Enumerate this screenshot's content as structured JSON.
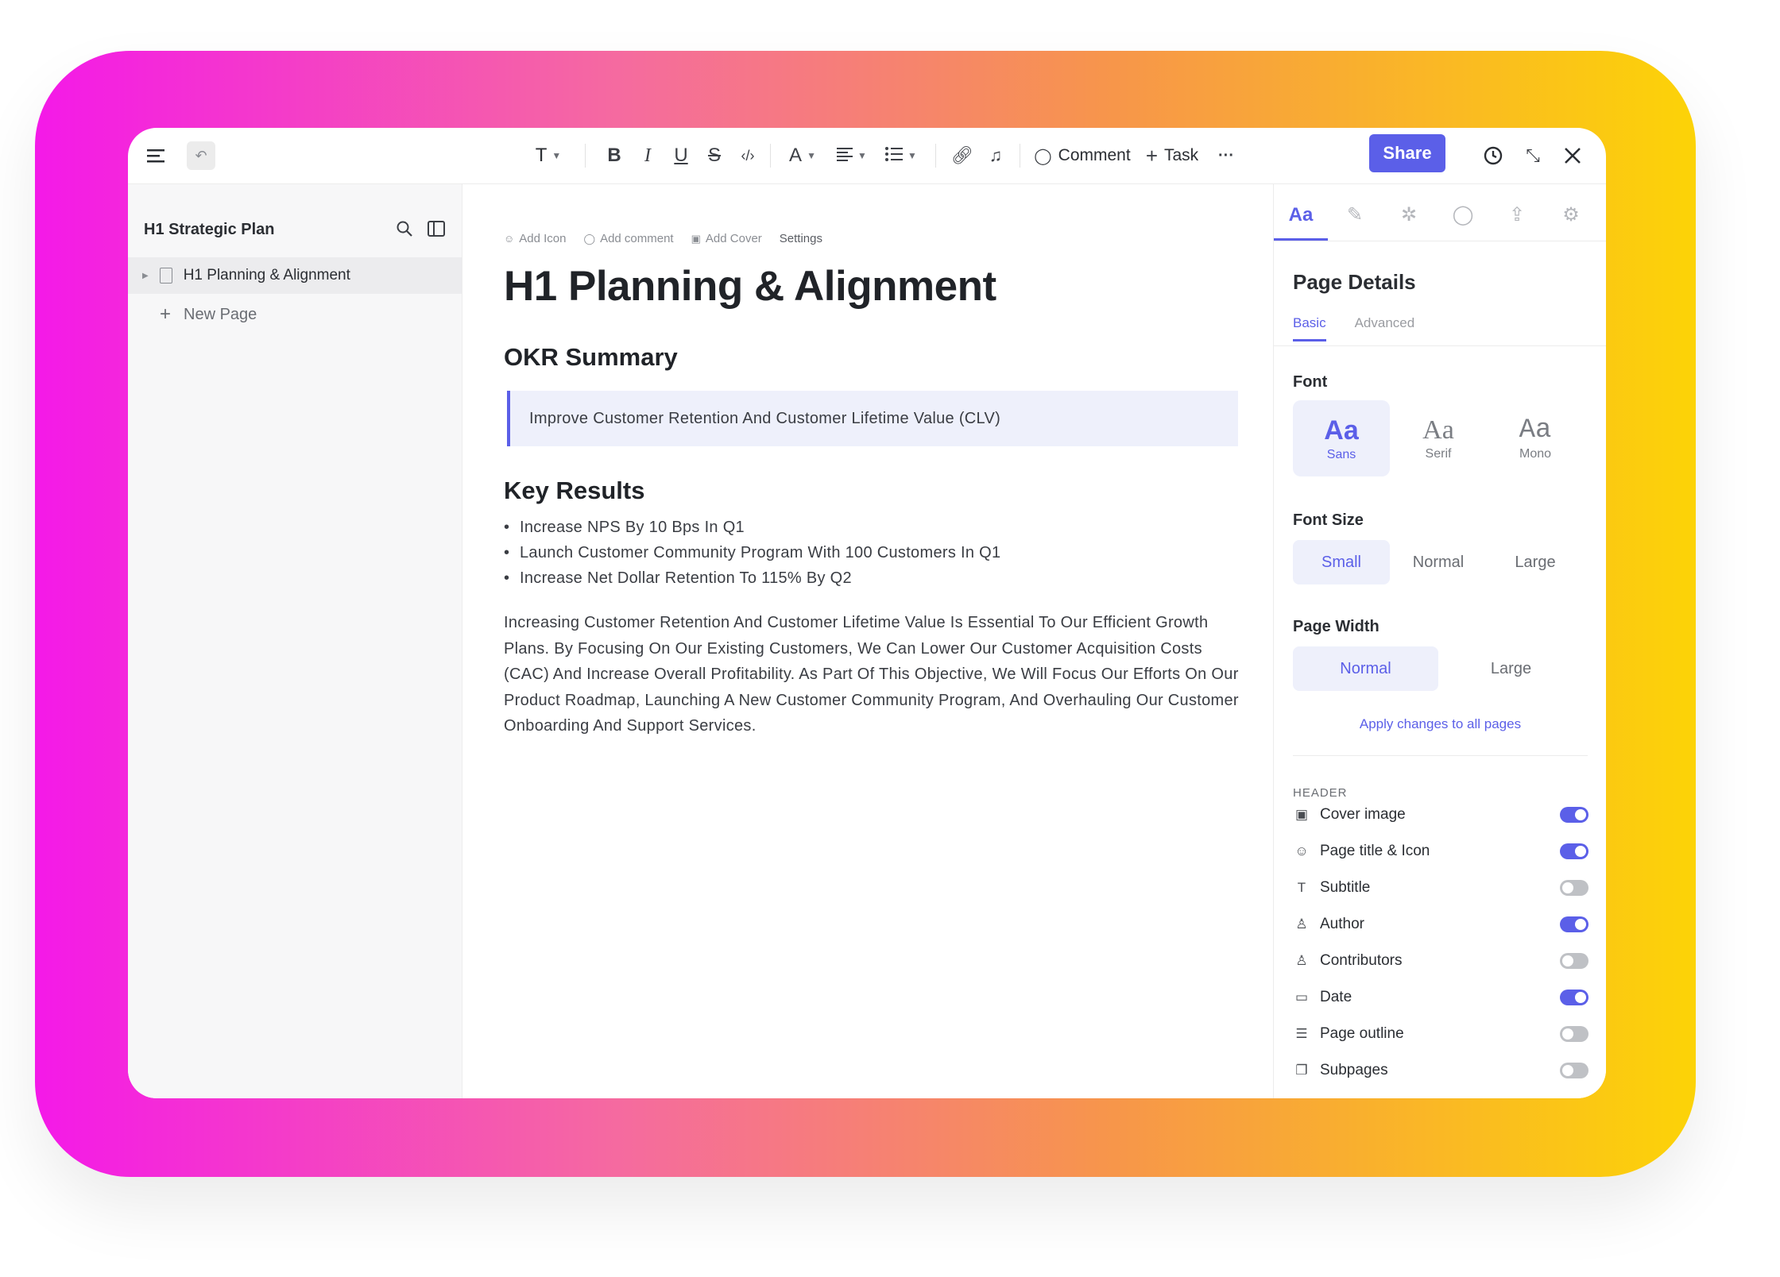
{
  "toolbar": {
    "text_style_label": "T",
    "comment_label": "Comment",
    "task_label": "Task",
    "more_label": "···",
    "share_label": "Share"
  },
  "sidebar": {
    "title": "H1 Strategic Plan",
    "pages": [
      {
        "label": "H1 Planning & Alignment"
      }
    ],
    "new_page_label": "New Page"
  },
  "document": {
    "meta_actions": {
      "add_icon": "Add Icon",
      "add_comment": "Add comment",
      "add_cover": "Add Cover",
      "settings": "Settings"
    },
    "title": "H1 Planning & Alignment",
    "okr_heading": "OKR Summary",
    "objective": "Improve Customer Retention And Customer Lifetime Value (CLV)",
    "key_results_heading": "Key Results",
    "key_results": [
      "Increase NPS By 10 Bps In Q1",
      "Launch Customer Community Program With 100 Customers In Q1",
      "Increase Net Dollar Retention To 115% By Q2"
    ],
    "paragraph": "Increasing Customer Retention And Customer Lifetime Value Is Essential To Our Efficient Growth Plans. By Focusing On Our Existing Customers, We Can Lower Our Customer Acquisition Costs (CAC) And Increase Overall Profitability. As Part Of This Objective, We Will Focus Our Efforts On Our Product Roadmap, Launching A New Customer Community Program, And Overhauling Our Customer Onboarding And Support Services."
  },
  "panel": {
    "active_tab_label": "Aa",
    "title": "Page Details",
    "subtabs": {
      "basic": "Basic",
      "advanced": "Advanced"
    },
    "font": {
      "label": "Font",
      "options": [
        {
          "glyph": "Aa",
          "name": "Sans",
          "selected": true
        },
        {
          "glyph": "Aa",
          "name": "Serif",
          "selected": false
        },
        {
          "glyph": "Aa",
          "name": "Mono",
          "selected": false
        }
      ]
    },
    "font_size": {
      "label": "Font Size",
      "options": [
        "Small",
        "Normal",
        "Large"
      ],
      "selected": "Small"
    },
    "page_width": {
      "label": "Page Width",
      "options": [
        "Normal",
        "Large"
      ],
      "selected": "Normal"
    },
    "apply_label": "Apply changes to all pages",
    "header_label": "HEADER",
    "toggles": [
      {
        "label": "Cover image",
        "icon": "image-icon",
        "on": true
      },
      {
        "label": "Page title & Icon",
        "icon": "smiley-icon",
        "on": true
      },
      {
        "label": "Subtitle",
        "icon": "text-size-icon",
        "on": false
      },
      {
        "label": "Author",
        "icon": "person-icon",
        "on": true
      },
      {
        "label": "Contributors",
        "icon": "people-icon",
        "on": false
      },
      {
        "label": "Date",
        "icon": "calendar-icon",
        "on": true
      },
      {
        "label": "Page outline",
        "icon": "outline-icon",
        "on": false
      },
      {
        "label": "Subpages",
        "icon": "subpages-icon",
        "on": false
      }
    ]
  },
  "colors": {
    "accent": "#5b5fe8",
    "accent_light": "#eef0fb"
  }
}
